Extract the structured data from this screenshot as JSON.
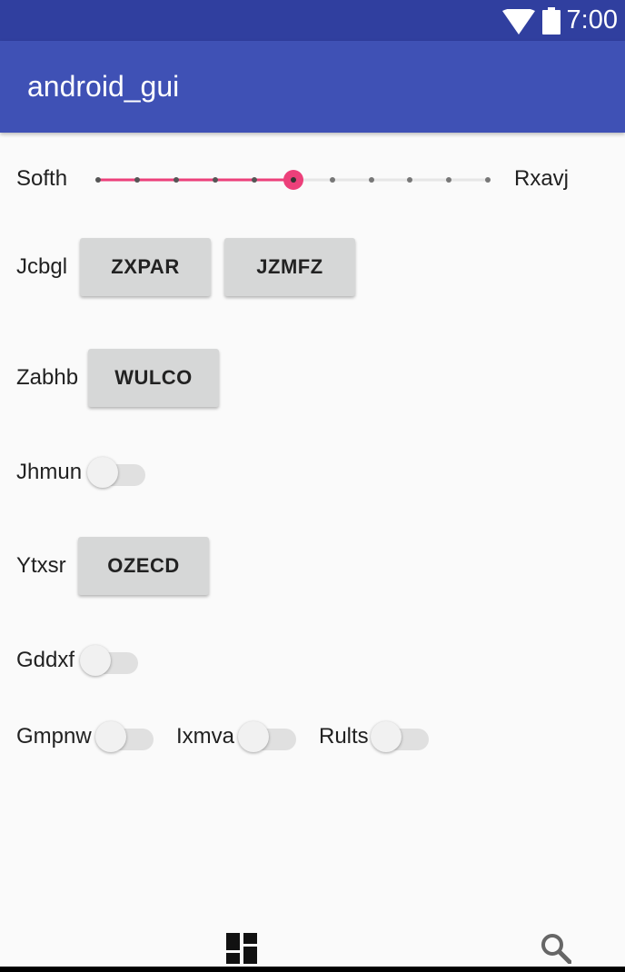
{
  "status_bar": {
    "time": "7:00"
  },
  "app_bar": {
    "title": "android_gui"
  },
  "slider": {
    "left_label": "Softh",
    "right_label": "Rxavj",
    "value_step": 5,
    "step_count": 10,
    "accent_color": "#ec407a"
  },
  "rows": {
    "jcbgl": {
      "label": "Jcbgl",
      "buttons": [
        "ZXPAR",
        "JZMFZ"
      ]
    },
    "zabhb": {
      "label": "Zabhb",
      "button": "WULCO"
    },
    "jhmun": {
      "label": "Jhmun",
      "checked": false
    },
    "ytxsr": {
      "label": "Ytxsr",
      "button": "OZECD"
    },
    "gddxf": {
      "label": "Gddxf",
      "checked": false
    },
    "switches": [
      {
        "label": "Gmpnw",
        "checked": false
      },
      {
        "label": "Ixmva",
        "checked": false
      },
      {
        "label": "Rults",
        "checked": false
      }
    ]
  },
  "bottom_nav": {
    "left_icon": "dashboard-icon",
    "right_icon": "search-icon"
  },
  "colors": {
    "primary": "#3f51b5",
    "primary_dark": "#303f9f",
    "accent": "#ec407a"
  }
}
